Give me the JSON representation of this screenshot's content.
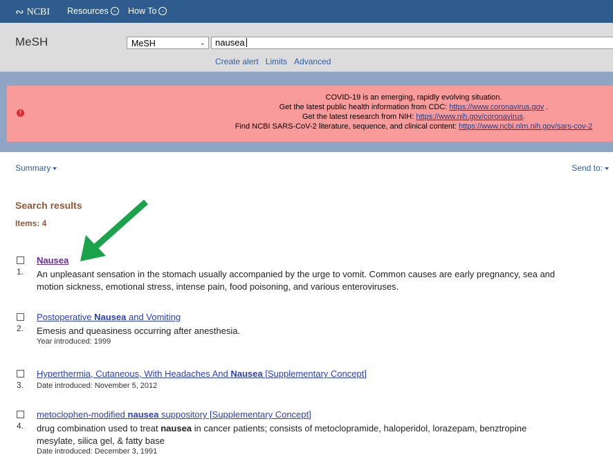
{
  "topnav": {
    "logo": "NCBI",
    "menu_resources": "Resources",
    "menu_howto": "How To"
  },
  "search": {
    "db_title": "MeSH",
    "db_selected": "MeSH",
    "query": "nausea",
    "links": [
      "Create alert",
      "Limits",
      "Advanced"
    ]
  },
  "alert": {
    "line1": "COVID-19 is an emerging, rapidly evolving situation.",
    "line2_text": "Get the latest public health information from CDC: ",
    "line2_link": "https://www.coronavirus.gov",
    "line2_tail": " .",
    "line3_text": "Get the latest research from NIH: ",
    "line3_link": "https://www.nih.gov/coronavirus",
    "line3_tail": ".",
    "line4_text": "Find NCBI SARS-CoV-2 literature, sequence, and clinical content: ",
    "line4_link": "https://www.ncbi.nlm.nih.gov/sars-cov-2"
  },
  "toolbar": {
    "summary": "Summary",
    "send_to": "Send to:"
  },
  "results": {
    "title": "Search results",
    "count": "Items: 4",
    "items": [
      {
        "num": "1.",
        "title": "Nausea",
        "desc_line1": "An unpleasant sensation in the stomach usually accompanied by the urge to vomit. Common causes are early pregnancy, sea and",
        "desc_line2": "motion sickness, emotional stress, intense pain, food poisoning, and various enteroviruses."
      },
      {
        "num": "2.",
        "title_pre": "Postoperative ",
        "title_bold": "Nausea",
        "title_post": " and Vomiting",
        "desc_line1": "Emesis and queasiness occurring after anesthesia.",
        "meta": "Year introduced: 1999"
      },
      {
        "num": "3.",
        "title_pre": "Hyperthermia, Cutaneous, With Headaches And ",
        "title_bold": "Nausea",
        "title_post": " [Supplementary Concept]",
        "meta": "Date introduced: November 5, 2012"
      },
      {
        "num": "4.",
        "title_pre": "metoclophen-modified ",
        "title_bold": "nausea",
        "title_post": " suppository [Supplementary Concept]",
        "desc_pre": "drug combination used to treat ",
        "desc_bold": "nausea",
        "desc_post": " in cancer patients; consists of metoclopramide, haloperidol, lorazepam, benztropine",
        "desc_line2": "mesylate, silica gel, & fatty base",
        "meta": "Date introduced: December 3, 1991"
      }
    ]
  },
  "colors": {
    "nav_bg": "#2f5c8f",
    "alert_bg": "#fa9b9b",
    "alert_band": "#8ea6c3",
    "heading": "#985735",
    "link": "#2a3fbf",
    "visited": "#6a2a9a",
    "annotation_arrow": "#1aa34a"
  }
}
